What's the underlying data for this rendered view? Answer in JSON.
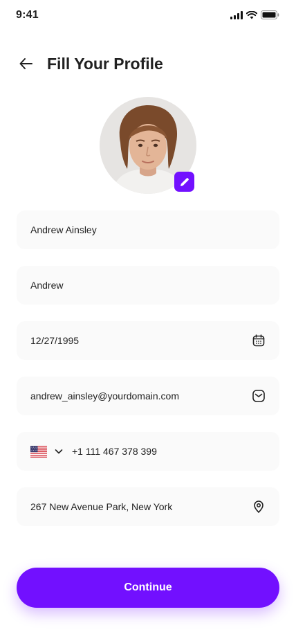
{
  "status_bar": {
    "time": "9:41"
  },
  "header": {
    "title": "Fill Your Profile"
  },
  "form": {
    "full_name": "Andrew Ainsley",
    "nickname": "Andrew",
    "date_of_birth": "12/27/1995",
    "email": "andrew_ainsley@yourdomain.com",
    "phone": "+1 111 467 378 399",
    "address": "267 New Avenue Park, New York"
  },
  "actions": {
    "continue_label": "Continue"
  },
  "icons": {
    "back": "arrow-left-icon",
    "edit": "pencil-icon",
    "calendar": "calendar-icon",
    "email": "mail-icon",
    "country_flag": "us-flag-icon",
    "dropdown": "chevron-down-icon",
    "location": "location-pin-icon"
  },
  "colors": {
    "primary": "#7210ff",
    "text": "#212121",
    "field_bg": "#fafafa"
  }
}
